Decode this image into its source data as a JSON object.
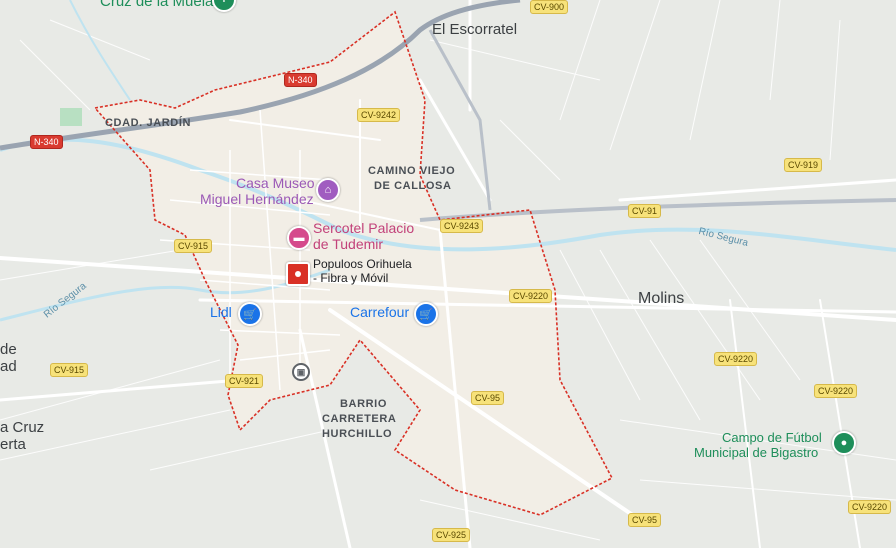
{
  "colors": {
    "land": "#e8eae6",
    "urban": "#f2eee6",
    "boundary": "#d93025",
    "river": "#bfe3f0",
    "road": "#ffffff",
    "motorway": "#9aa4b1"
  },
  "places": {
    "el_escorratel": "El Escorratel",
    "molins": "Molins",
    "cruz_muela": "Cruz de la Muela",
    "left_de": "de",
    "left_ad": "ad",
    "left_a_cruz": "a Cruz",
    "left_erta": "erta"
  },
  "neighborhoods": {
    "cdad_jardin": "CDAD. JARDÍN",
    "camino_viejo_1": "CAMINO VIEJO",
    "camino_viejo_2": "DE CALLOSA",
    "barrio_1": "BARRIO",
    "barrio_2": "CARRETERA",
    "barrio_3": "HURCHILLO"
  },
  "pois": {
    "casa_museo_1": "Casa Museo",
    "casa_museo_2": "Miguel Hernández",
    "sercotel_1": "Sercotel Palacio",
    "sercotel_2": "de Tudemir",
    "populoos_1": "Populoos Orihuela",
    "populoos_2": "- Fibra y Móvil",
    "lidl": "Lidl",
    "carrefour": "Carrefour",
    "campo_1": "Campo de Fútbol",
    "campo_2": "Municipal de Bigastro"
  },
  "rivers": {
    "rio_segura_left": "Río Segura",
    "rio_segura_right": "Río Segura"
  },
  "road_shields": {
    "cv900": "CV-900",
    "n340_top": "N-340",
    "n340_left": "N-340",
    "cv9242": "CV-9242",
    "cv919": "CV-919",
    "cv91": "CV-91",
    "cv9243": "CV-9243",
    "cv915_top": "CV-915",
    "cv9220_mid": "CV-9220",
    "cv9220_right": "CV-9220",
    "cv9220_far": "CV-9220",
    "cv915_left": "CV-915",
    "cv921": "CV-921",
    "cv95_mid": "CV-95",
    "cv95_bottom": "CV-95",
    "cv925": "CV-925",
    "cv9220_bottom": "CV-9220"
  },
  "icons": {
    "museum": "museum-icon",
    "hotel": "hotel-icon",
    "shop": "cart-icon",
    "station": "train-icon",
    "sports": "stadium-icon",
    "location": "location-pin-icon"
  }
}
